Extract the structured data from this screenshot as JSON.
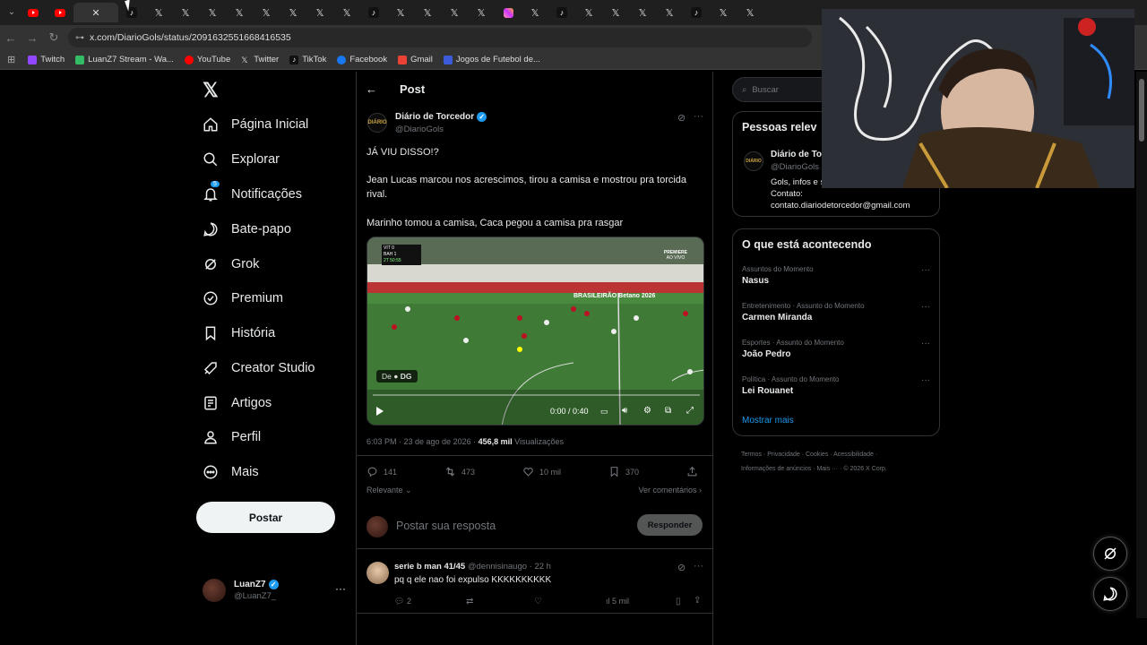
{
  "browser": {
    "url": "x.com/DiarioGols/status/2091632551668416535",
    "tabs_count": 37,
    "bookmarks": [
      {
        "label": "Twitch",
        "color": "#9146ff"
      },
      {
        "label": "LuanZ7 Stream - Wa...",
        "color": "#3b6"
      },
      {
        "label": "YouTube",
        "color": "#f00"
      },
      {
        "label": "Twitter",
        "color": "#ddd"
      },
      {
        "label": "TikTok",
        "color": "#000"
      },
      {
        "label": "Facebook",
        "color": "#1877f2"
      },
      {
        "label": "Gmail",
        "color": "#ea4335"
      },
      {
        "label": "Jogos de Futebol de...",
        "color": "#3b5bdb"
      }
    ]
  },
  "sidebar": {
    "logo": "𝕏",
    "items": [
      {
        "label": "Página Inicial",
        "icon": "home-icon"
      },
      {
        "label": "Explorar",
        "icon": "search-icon"
      },
      {
        "label": "Notificações",
        "icon": "bell-icon",
        "badge": "5"
      },
      {
        "label": "Bate-papo",
        "icon": "chat-icon"
      },
      {
        "label": "Grok",
        "icon": "grok-icon"
      },
      {
        "label": "Premium",
        "icon": "verified-icon"
      },
      {
        "label": "História",
        "icon": "bookmark-icon"
      },
      {
        "label": "Creator Studio",
        "icon": "rocket-icon"
      },
      {
        "label": "Artigos",
        "icon": "article-icon"
      },
      {
        "label": "Perfil",
        "icon": "person-icon"
      },
      {
        "label": "Mais",
        "icon": "more-circle-icon"
      }
    ],
    "post_button": "Postar",
    "profile": {
      "name": "LuanZ7",
      "handle": "@LuanZ7_",
      "more": "···"
    }
  },
  "post": {
    "header_title": "Post",
    "author_name": "Diário de Torcedor",
    "author_handle": "@DiarioGols",
    "text_1": "JÁ VIU DISSO!?",
    "text_2": "Jean Lucas marcou nos acrescimos, tirou a camisa e mostrou pra torcida rival.",
    "text_3": "Marinho tomou a camisa, Caca pegou a camisa pra rasgar",
    "video": {
      "source_prefix": "De",
      "source_name": "DG",
      "time": "0:00 / 0:40",
      "progress": 0.0,
      "score_team1": "VIT",
      "score_team1_goals": "0",
      "score_team2": "BAH",
      "score_team2_goals": "1",
      "clock": "2T 50:55",
      "broadcaster": "PREMIERE",
      "broadcaster_sub": "AO VIVO",
      "ad_banner": "BRASILEIRÃO Betano 2026"
    },
    "timestamp": "6:03 PM · 23 de ago de 2026",
    "views": "456,8 mil",
    "views_label": "Visualizações",
    "stats": {
      "replies": "141",
      "reposts": "473",
      "likes": "10 mil",
      "bookmarks": "370"
    },
    "sort_label": "Relevante",
    "see_comments": "Ver comentários"
  },
  "reply_composer": {
    "placeholder": "Postar sua resposta",
    "button": "Responder"
  },
  "comment": {
    "author_name": "serie b man 41/45",
    "author_handle": "@dennisinaugo",
    "time": "· 22 h",
    "text": "pq q ele nao foi expulso KKKKKKKKKK",
    "replies": "2",
    "views": "5 mil"
  },
  "right": {
    "search_placeholder": "Buscar",
    "people_title": "Pessoas relev",
    "person_name": "Diário de To",
    "person_handle": "@DiarioGols",
    "person_bio": "Gols, infos e s",
    "person_contact_label": "Contato:",
    "person_contact": "contato.diariodetorcedor@gmail.com",
    "trends_title": "O que está acontecendo",
    "trends": [
      {
        "meta": "Assuntos do Momento",
        "name": "Nasus"
      },
      {
        "meta": "Entretenimento · Assunto do Momento",
        "name": "Carmen Miranda"
      },
      {
        "meta": "Esportes · Assunto do Momento",
        "name": "João Pedro"
      },
      {
        "meta": "Política · Assunto do Momento",
        "name": "Lei Rouanet"
      }
    ],
    "show_more": "Mostrar mais",
    "footer": [
      "Termos",
      "Privacidade",
      "Cookies",
      "Acessibilidade",
      "Informações de anúncios",
      "Mais ···",
      "© 2026 X Corp."
    ]
  },
  "colors": {
    "accent": "#1d9bf0",
    "bg": "#000000",
    "border": "#2f3336",
    "muted": "#71767b"
  }
}
